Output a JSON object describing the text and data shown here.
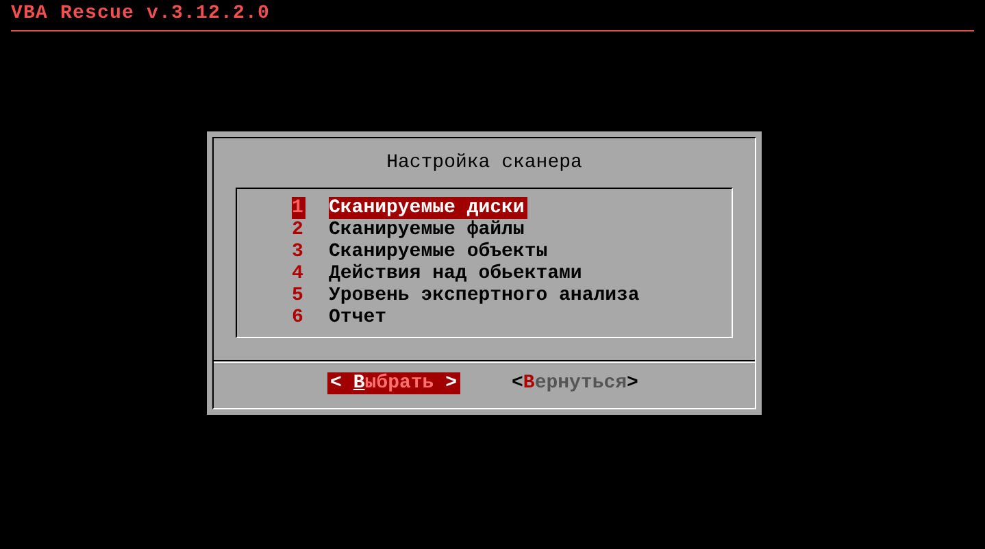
{
  "header": {
    "title": "VBA Rescue v.3.12.2.0"
  },
  "dialog": {
    "title": "Настройка сканера",
    "items": [
      {
        "number": "1",
        "label": "Сканируемые диски",
        "selected": true
      },
      {
        "number": "2",
        "label": "Сканируемые файлы",
        "selected": false
      },
      {
        "number": "3",
        "label": "Сканируемые объекты",
        "selected": false
      },
      {
        "number": "4",
        "label": "Действия над обьектами",
        "selected": false
      },
      {
        "number": "5",
        "label": "Уровень экспертного анализа",
        "selected": false
      },
      {
        "number": "6",
        "label": "Отчет",
        "selected": false
      }
    ],
    "buttons": [
      {
        "left": "< ",
        "hotkey": "В",
        "rest": "ыбрать",
        "right": " >",
        "selected": true
      },
      {
        "left": "<",
        "hotkey": "В",
        "rest": "ернуться",
        "right": ">",
        "selected": false
      }
    ]
  }
}
